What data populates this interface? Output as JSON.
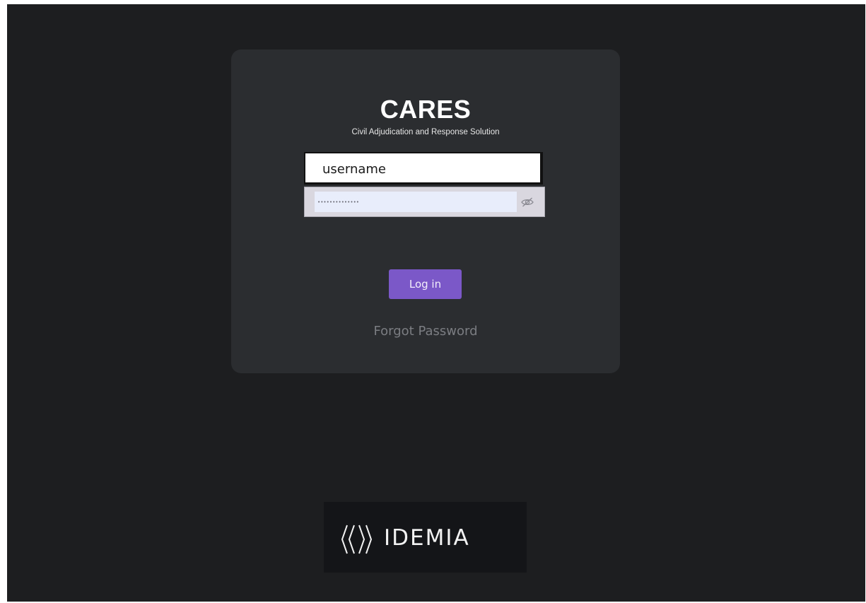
{
  "login": {
    "title": "CARES",
    "subtitle": "Civil Adjudication and Response Solution",
    "username_value": "username",
    "password_value": "••••••••••••••",
    "login_label": "Log in",
    "forgot_label": "Forgot Password",
    "password_toggle_icon": "eye-slash-icon"
  },
  "brand": {
    "logo_icon": "idemia-chevron-logo-icon",
    "name": "IDEMIA"
  },
  "colors": {
    "background": "#1d1e20",
    "card": "#2b2d30",
    "accent": "#7b58c8",
    "link": "#7b7d82",
    "password_fill": "#e8edfb"
  }
}
